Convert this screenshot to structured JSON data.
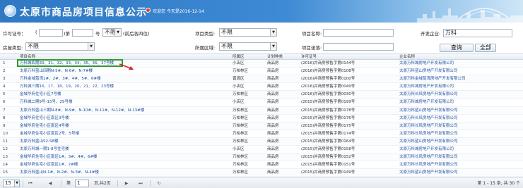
{
  "header": {
    "title": "太原市商品房项目信息公示",
    "welcome": "欢迎您  今天是2016-12-14"
  },
  "search": {
    "permit_label": "许可证号：",
    "permit_open": "(",
    "permit_year": "",
    "permit_close": ")第",
    "permit_number": "",
    "hao_label": "号",
    "permit_select": "不限",
    "permit_hint": "(前后各四位)",
    "project_type_label": "项目类型:",
    "project_type_value": "不限",
    "project_name_label": "项目名称:",
    "project_name_value": "",
    "developer_label": "开发企业:",
    "developer_value": "万科",
    "house_type_label": "房屋类型:",
    "house_type_value": "不限",
    "district_label": "所属区域:",
    "district_value": "不限",
    "project_address_label": "项目坐落:",
    "project_address_value": "",
    "query_button": "查询",
    "all_button": "全部"
  },
  "table": {
    "columns": [
      "项目名称",
      "所属区",
      "计划种类",
      "许可证号",
      "企业名称"
    ],
    "rows": [
      {
        "idx": "1",
        "name": "万科城四期30、31、32、33、34、35、36、37号楼",
        "area": "小店区",
        "type": "商品房",
        "permit": "(2016)并商房预售字第0144号",
        "dev": "太原万科城房地产开发有限公司"
      },
      {
        "idx": "2",
        "name": "太原万科蓝山四期N-5#、N-6#、N-7#楼",
        "area": "万柏林区",
        "type": "商品房",
        "permit": "(2016)并商房预售字第0108号",
        "dev": "太原万科蓝山房地产开发有限公司"
      },
      {
        "idx": "3",
        "name": "万科金域蓝湾1#、2#、3#、4#、5#、6#楼",
        "area": "晋源区",
        "type": "商品房",
        "permit": "(2016)并商房预售字第0100号",
        "dev": "太原万科金域蓝湾房地产开发有限公司"
      },
      {
        "idx": "4",
        "name": "万科城三期16、17、18、19、20、21、22、23号楼",
        "area": "小店区",
        "type": "商品房",
        "permit": "(2016)并商房预售字第0049号",
        "dev": "太原万科城房地产开发有限公司"
      },
      {
        "idx": "5",
        "name": "金域华府住宅小区7号楼",
        "area": "万柏林区",
        "type": "商品房",
        "permit": "(2016)并商房预售字第0030号",
        "dev": "太原万科长风房地产开发有限公司"
      },
      {
        "idx": "6",
        "name": "万科城二期9号-15号、29号楼",
        "area": "小店区",
        "type": "商品房",
        "permit": "(2015)并商房预售字第0199号",
        "dev": "太原万科城房地产开发有限公司"
      },
      {
        "idx": "7",
        "name": "太原万科蓝山三期N-8#、N-9#、N-10#、N-11#、N-12#、N-13#楼",
        "area": "万柏林区",
        "type": "商品房",
        "permit": "(2015)并商房预售字第0178号",
        "dev": "太原万科蓝山房地产开发有限公司"
      },
      {
        "idx": "8",
        "name": "金域华府住宅小区南区3号楼",
        "area": "万柏林区",
        "type": "商品房",
        "permit": "(2015)并商房预售字第0176号",
        "dev": "太原万科长风房地产开发有限公司"
      },
      {
        "idx": "9",
        "name": "金域华府住宅小区南区4号楼",
        "area": "万柏林区",
        "type": "商品房",
        "permit": "(2015)并商房预售字第0175号",
        "dev": "太原万科长风房地产开发有限公司"
      },
      {
        "idx": "10",
        "name": "金域华府住宅小区南区2号、5号楼",
        "area": "万柏林区",
        "type": "商品房",
        "permit": "(2015)并商房预售字第0174号",
        "dev": "太原万科长风房地产开发有限公司"
      },
      {
        "idx": "11",
        "name": "太原万科蓝山S2-S8楼",
        "area": "万柏林区",
        "type": "商品房",
        "permit": "(2015)并商房预售字第0164号",
        "dev": "太原万科蓝山房地产开发有限公司"
      },
      {
        "idx": "12",
        "name": "太原万科城一期1-8号住宅楼",
        "area": "小店区",
        "type": "商品房",
        "permit": "(2015)并商房预售字第0158号",
        "dev": "太原万科城房地产开发有限公司"
      },
      {
        "idx": "13",
        "name": "金域华府住宅小区南区1#、3#、4#、6#楼",
        "area": "万柏林区",
        "type": "商品房",
        "permit": "(2015)并商房预售字第0152号",
        "dev": "太原万科长风房地产开发有限公司"
      },
      {
        "idx": "14",
        "name": "金域华府住宅小区南区1#、2#楼",
        "area": "万柏林区",
        "type": "商品房",
        "permit": "(2015)并商房预售字第0151号",
        "dev": "太原万科长风房地产开发有限公司"
      },
      {
        "idx": "15",
        "name": "太原万科蓝山N-1#、N-2#、N-3#、N-4#楼",
        "area": "万柏林区",
        "type": "商品房",
        "permit": "(2015)并商房预售字第0149号",
        "dev": "太原万科蓝山房地产开发有限公司"
      }
    ]
  },
  "pager": {
    "page_size": "15",
    "page_label": "第",
    "page_value": "1",
    "page_total": "页,共2页",
    "summary": "第 1 - 15 条, 共 30 个"
  },
  "colors": {
    "banner": "#3e8ad4",
    "link": "#1f4fa0",
    "highlight": "#2e9a2e",
    "arrow": "#d02525"
  }
}
